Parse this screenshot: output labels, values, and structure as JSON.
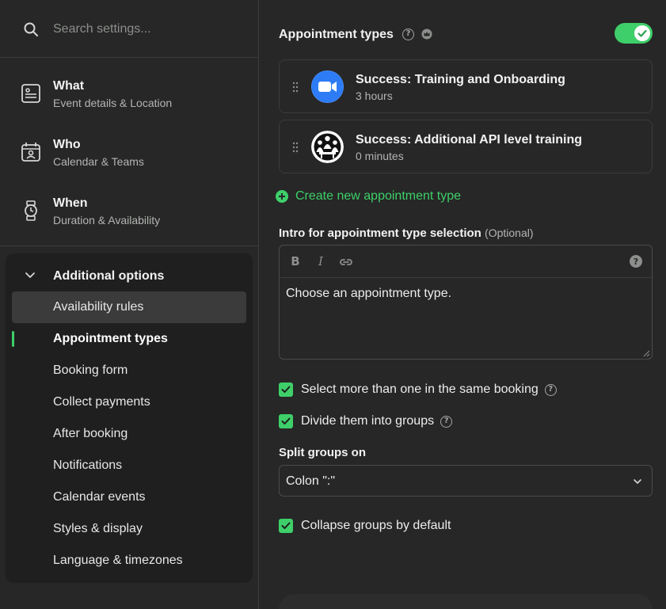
{
  "search": {
    "placeholder": "Search settings..."
  },
  "nav": {
    "items": [
      {
        "title": "What",
        "subtitle": "Event details & Location",
        "icon": "id-card-icon"
      },
      {
        "title": "Who",
        "subtitle": "Calendar & Teams",
        "icon": "calendar-person-icon"
      },
      {
        "title": "When",
        "subtitle": "Duration & Availability",
        "icon": "watch-icon"
      }
    ]
  },
  "additional": {
    "label": "Additional options",
    "items": [
      {
        "label": "Availability rules",
        "state": "hover"
      },
      {
        "label": "Appointment types",
        "state": "active"
      },
      {
        "label": "Booking form"
      },
      {
        "label": "Collect payments"
      },
      {
        "label": "After booking"
      },
      {
        "label": "Notifications"
      },
      {
        "label": "Calendar events"
      },
      {
        "label": "Styles & display"
      },
      {
        "label": "Language & timezones"
      }
    ]
  },
  "main": {
    "title": "Appointment types",
    "toggle_on": true,
    "accent_color": "#3ecf6a",
    "cards": [
      {
        "title": "Success: Training and Onboarding",
        "subtitle": "3 hours",
        "icon": "video-camera-icon"
      },
      {
        "title": "Success: Additional API level training",
        "subtitle": "0 minutes",
        "icon": "people-icon"
      }
    ],
    "create_label": "Create new appointment type",
    "intro": {
      "label": "Intro for appointment type selection",
      "optional": "(Optional)",
      "content": "Choose an appointment type.",
      "toolbar": [
        "bold-icon",
        "italic-icon",
        "link-icon"
      ]
    },
    "checkboxes": [
      {
        "label": "Select more than one in the same booking",
        "checked": true,
        "help": true
      },
      {
        "label": "Divide them into groups",
        "checked": true,
        "help": true
      }
    ],
    "split": {
      "label": "Split groups on",
      "value": "Colon \":\""
    },
    "collapse": {
      "label": "Collapse groups by default",
      "checked": true
    }
  }
}
